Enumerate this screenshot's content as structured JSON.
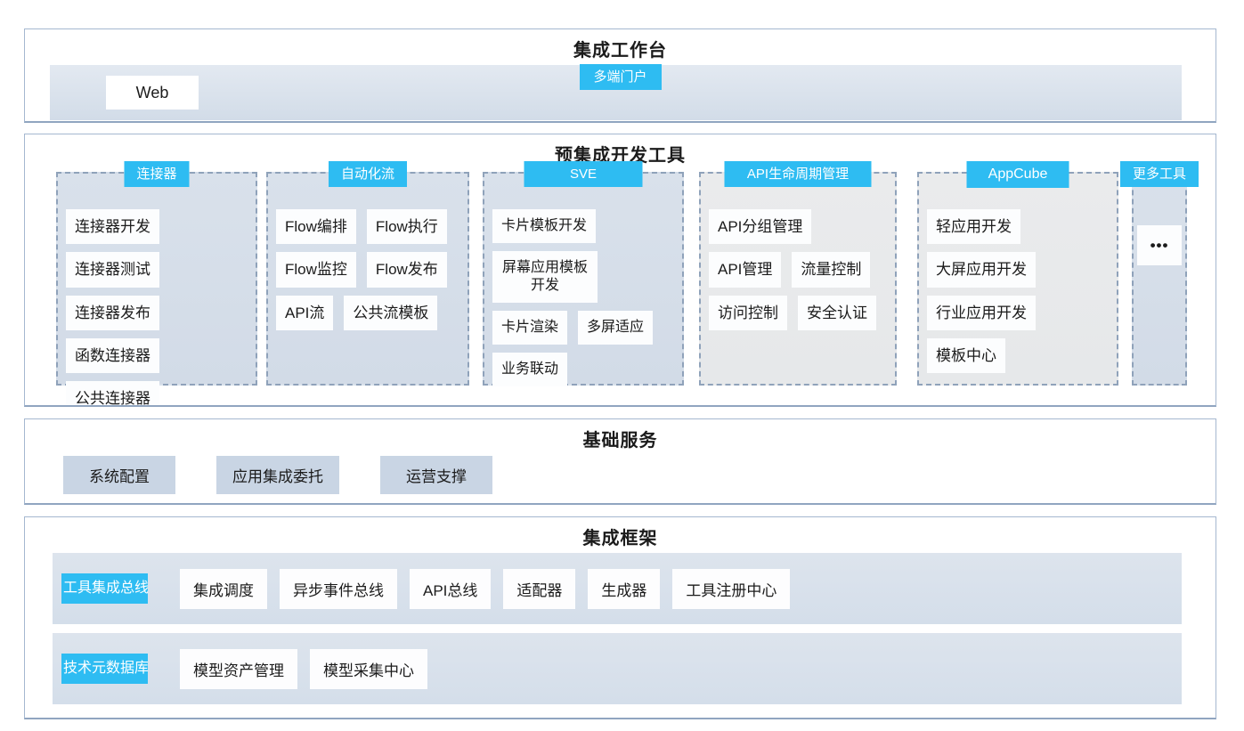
{
  "colors": {
    "accent": "#2ebcf2",
    "section_border": "#a5b8d0",
    "panel_blue": "#d5dfe9",
    "panel_grey": "#e9eaec",
    "item_bg": "#fcfdfe",
    "service_box": "#c9d5e4"
  },
  "workbench": {
    "title": "集成工作台",
    "portal_tag": "多端门户",
    "client_label": "Web"
  },
  "dev_tools": {
    "title": "预集成开发工具",
    "columns": [
      {
        "tag": "连接器",
        "style": "blue",
        "items": [
          "连接器开发",
          "连接器测试",
          "连接器发布",
          "函数连接器",
          "公共连接器"
        ]
      },
      {
        "tag": "自动化流",
        "style": "blue",
        "items": [
          "Flow编排",
          "Flow执行",
          "Flow监控",
          "Flow发布",
          "API流",
          "公共流模板"
        ]
      },
      {
        "tag": "SVE",
        "style": "blue",
        "items": [
          "卡片模板开发",
          "屏幕应用模板开发",
          "卡片渲染",
          "多屏适应",
          "业务联动"
        ]
      },
      {
        "tag": "API生命周期管理",
        "style": "grey",
        "items": [
          "API分组管理",
          "API管理",
          "流量控制",
          "访问控制",
          "安全认证"
        ]
      },
      {
        "tag": "AppCube",
        "style": "grey",
        "items": [
          "轻应用开发",
          "大屏应用开发",
          "行业应用开发",
          "模板中心"
        ]
      },
      {
        "tag": "更多工具",
        "style": "blue",
        "items": [
          "•••"
        ]
      }
    ]
  },
  "basic_services": {
    "title": "基础服务",
    "items": [
      "系统配置",
      "应用集成委托",
      "运营支撑"
    ]
  },
  "framework": {
    "title": "集成框架",
    "rows": [
      {
        "tag": "工具集成总线",
        "items": [
          "集成调度",
          "异步事件总线",
          "API总线",
          "适配器",
          "生成器",
          "工具注册中心"
        ]
      },
      {
        "tag": "技术元数据库",
        "items": [
          "模型资产管理",
          "模型采集中心"
        ]
      }
    ]
  }
}
